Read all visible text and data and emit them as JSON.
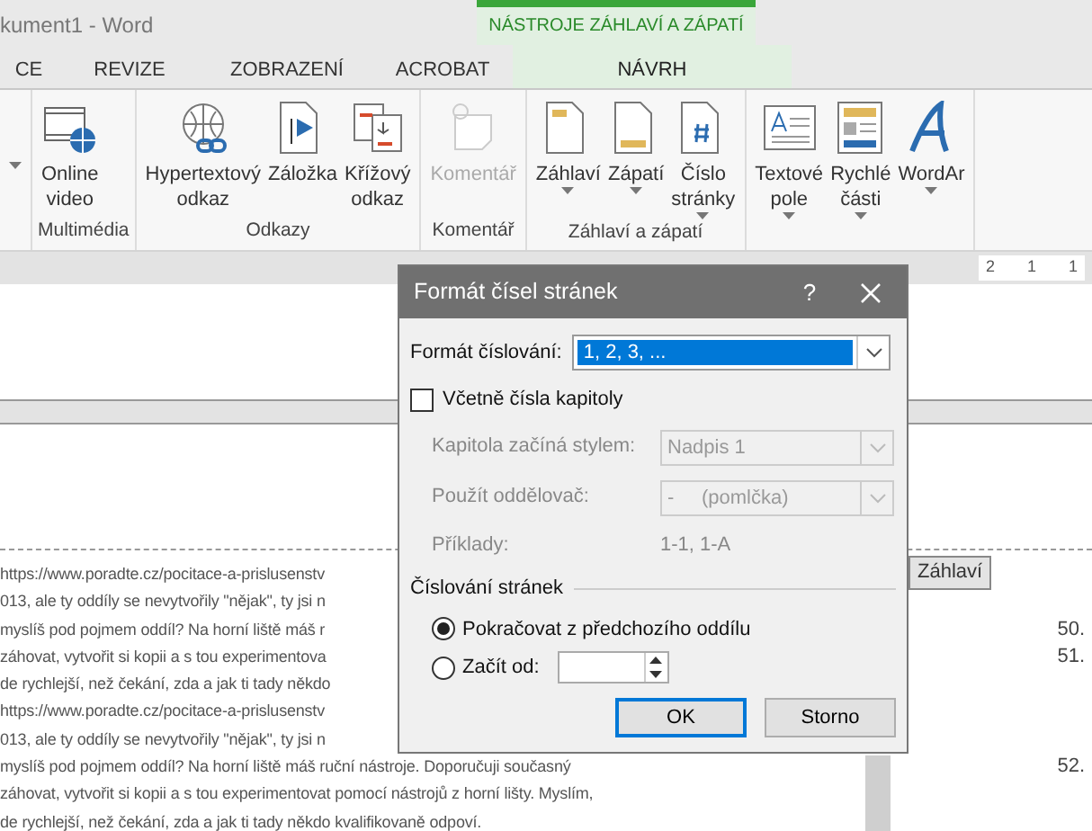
{
  "title_bar": {
    "document_title": "kument1 - Word",
    "contextual_group": "NÁSTROJE ZÁHLAVÍ A ZÁPATÍ"
  },
  "tabs": [
    {
      "label": "CE",
      "selected": false,
      "contextual": false
    },
    {
      "label": "REVIZE",
      "selected": false,
      "contextual": false
    },
    {
      "label": "ZOBRAZENÍ",
      "selected": false,
      "contextual": false
    },
    {
      "label": "ACROBAT",
      "selected": false,
      "contextual": false
    },
    {
      "label": "NÁVRH",
      "selected": true,
      "contextual": true
    }
  ],
  "ribbon_groups": [
    {
      "items": [
        {
          "dropdown": true,
          "disabled": false
        }
      ]
    },
    {
      "label": "Multimédia",
      "items": [
        {
          "lines": [
            "Online",
            "video"
          ],
          "dropdown": false,
          "disabled": false
        }
      ]
    },
    {
      "label": "Odkazy",
      "items": [
        {
          "lines": [
            "Hypertextový",
            "odkaz"
          ],
          "dropdown": false,
          "disabled": false
        },
        {
          "lines": [
            "Záložka"
          ],
          "dropdown": false,
          "disabled": false
        },
        {
          "lines": [
            "Křížový",
            "odkaz"
          ],
          "dropdown": false,
          "disabled": false
        }
      ]
    },
    {
      "label": "Komentář",
      "items": [
        {
          "lines": [
            "Komentář"
          ],
          "dropdown": false,
          "disabled": true
        }
      ]
    },
    {
      "label": "Záhlaví a zápatí",
      "items": [
        {
          "lines": [
            "Záhlaví"
          ],
          "dropdown": true,
          "disabled": false
        },
        {
          "lines": [
            "Zápatí"
          ],
          "dropdown": true,
          "disabled": false
        },
        {
          "lines": [
            "Číslo",
            "stránky"
          ],
          "dropdown": true,
          "disabled": false
        }
      ]
    },
    {
      "items": [
        {
          "lines": [
            "Textové",
            "pole"
          ],
          "dropdown": true,
          "disabled": false
        },
        {
          "lines": [
            "Rychlé",
            "části"
          ],
          "dropdown": true,
          "disabled": false
        },
        {
          "lines": [
            "WordAr"
          ],
          "dropdown": true,
          "disabled": false
        }
      ]
    }
  ],
  "ruler_marks": [
    "2",
    "1",
    "1"
  ],
  "document": {
    "header_tag": "Záhlaví",
    "lines": [
      {
        "text": "https://www.poradte.cz/pocitace-a-prislusenstv"
      },
      {
        "text": "013, ale ty oddíly se nevytvořily \"nějak\", ty jsi n"
      },
      {
        "text": "myslíš pod pojmem oddíl? Na horní liště máš r",
        "number": "50."
      },
      {
        "text": "záhovat, vytvořit si kopii a s tou experimentova",
        "number": "51."
      },
      {
        "text": "de rychlejší, než čekání, zda a jak ti tady někdo"
      },
      {
        "text": "https://www.poradte.cz/pocitace-a-prislusenstv"
      },
      {
        "text": "013, ale ty oddíly se nevytvořily \"nějak\", ty jsi n"
      },
      {
        "text": "myslíš pod pojmem oddíl? Na horní liště máš ruční nástroje. Doporučuji současný",
        "number": "52."
      },
      {
        "text": "záhovat, vytvořit si kopii a s tou experimentovat pomocí nástrojů z horní lišty. Myslím,"
      },
      {
        "text": "de rychlejší, než čekání, zda a jak ti tady někdo kvalifikovaně odpoví."
      }
    ]
  },
  "dialog": {
    "title": "Formát čísel stránek",
    "help": "?",
    "format": {
      "label": "Formát číslování:",
      "value": "1, 2, 3, ..."
    },
    "include_chapter": {
      "label": "Včetně čísla kapitoly",
      "checked": false
    },
    "chapter_rows": [
      {
        "label": "Kapitola začíná stylem:",
        "value": "Nadpis 1",
        "disabled": true
      },
      {
        "label": "Použít oddělovač:",
        "value": "-     (pomlčka)",
        "disabled": true
      }
    ],
    "examples": {
      "label": "Příklady:",
      "value": "1-1, 1-A",
      "disabled": true
    },
    "numbering": {
      "title": "Číslování stránek",
      "options": [
        {
          "label": "Pokračovat z předchozího oddílu",
          "selected": true,
          "kind": "plain"
        },
        {
          "label": "Začít od:",
          "selected": false,
          "kind": "spin"
        }
      ]
    },
    "buttons": [
      {
        "label": "OK",
        "default": true
      },
      {
        "label": "Storno",
        "default": false
      }
    ]
  }
}
